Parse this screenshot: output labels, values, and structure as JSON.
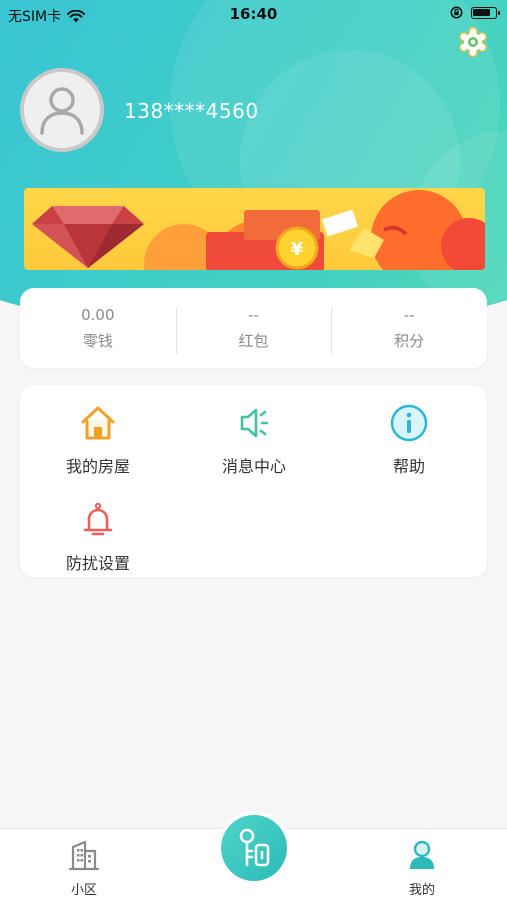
{
  "status_bar": {
    "carrier": "无SIM卡",
    "time": "16:40"
  },
  "profile": {
    "phone": "138****4560"
  },
  "stats": [
    {
      "value": "0.00",
      "label": "零钱"
    },
    {
      "value": "--",
      "label": "红包"
    },
    {
      "value": "--",
      "label": "积分"
    }
  ],
  "menu": {
    "items": [
      {
        "label": "我的房屋",
        "icon": "house-icon"
      },
      {
        "label": "消息中心",
        "icon": "speaker-icon"
      },
      {
        "label": "帮助",
        "icon": "info-icon"
      },
      {
        "label": "防扰设置",
        "icon": "bell-icon"
      }
    ]
  },
  "tabbar": {
    "tabs": [
      {
        "label": "小区",
        "icon": "building-icon"
      },
      {
        "label": "我的",
        "icon": "user-icon"
      }
    ],
    "center_icon": "key-icon"
  },
  "colors": {
    "header_gradient_start": "#39c3d6",
    "header_gradient_end": "#4fd8b6",
    "accent": "#2cb9ba",
    "banner": "#ffc93b"
  }
}
